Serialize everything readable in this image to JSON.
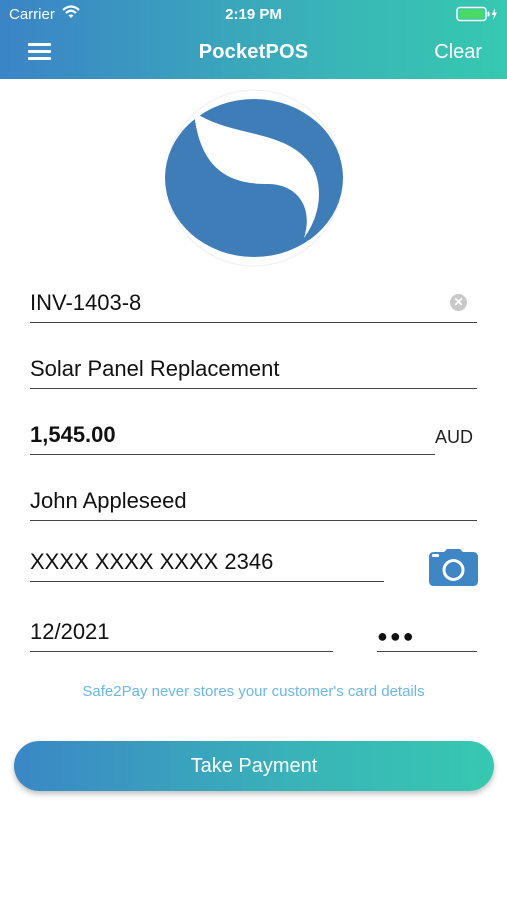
{
  "status": {
    "carrier": "Carrier",
    "time": "2:19 PM"
  },
  "header": {
    "title": "PocketPOS",
    "clear_label": "Clear"
  },
  "form": {
    "invoice": "INV-1403-8",
    "description": "Solar Panel Replacement",
    "amount": "1,545.00",
    "currency": "AUD",
    "customer_name": "John Appleseed",
    "card_number": "XXXX XXXX XXXX 2346",
    "expiry": "12/2021",
    "cvv_masked": "●●●"
  },
  "note": "Safe2Pay never stores your customer's card details",
  "actions": {
    "pay_label": "Take Payment"
  },
  "colors": {
    "accent_start": "#3b84c6",
    "accent_end": "#36c8b0",
    "logo": "#3f7db8",
    "note": "#6bb7e6"
  }
}
